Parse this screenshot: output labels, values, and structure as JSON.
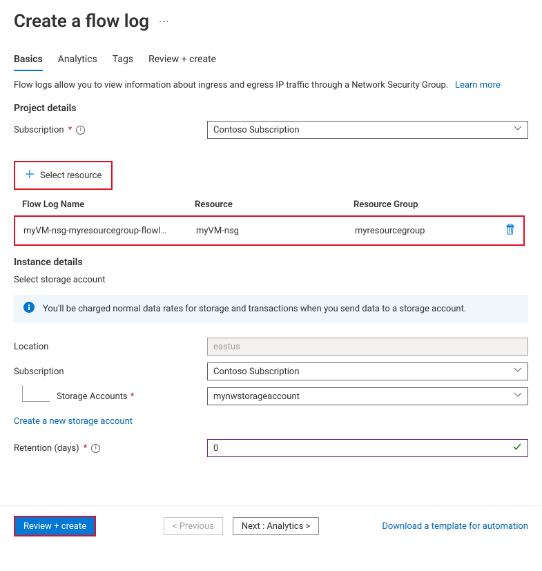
{
  "header": {
    "title": "Create a flow log"
  },
  "tabs": [
    {
      "label": "Basics",
      "active": true
    },
    {
      "label": "Analytics",
      "active": false
    },
    {
      "label": "Tags",
      "active": false
    },
    {
      "label": "Review + create",
      "active": false
    }
  ],
  "description": {
    "text": "Flow logs allow you to view information about ingress and egress IP traffic through a Network Security Group.",
    "learn_more": "Learn more"
  },
  "project": {
    "section_title": "Project details",
    "subscription_label": "Subscription",
    "subscription_value": "Contoso Subscription"
  },
  "select_resource_label": "Select resource",
  "resource_table": {
    "headers": {
      "name": "Flow Log Name",
      "resource": "Resource",
      "group": "Resource Group"
    },
    "row": {
      "name": "myVM-nsg-myresourcegroup-flowl…",
      "resource": "myVM-nsg",
      "group": "myresourcegroup"
    }
  },
  "instance": {
    "section_title": "Instance details",
    "subtitle": "Select storage account",
    "banner": "You'll be charged normal data rates for storage and transactions when you send data to a storage account.",
    "location_label": "Location",
    "location_value": "eastus",
    "subscription_label": "Subscription",
    "subscription_value": "Contoso Subscription",
    "storage_label": "Storage Accounts",
    "storage_value": "mynwstorageaccount",
    "new_storage_link": "Create a new storage account",
    "retention_label": "Retention (days)",
    "retention_value": "0"
  },
  "footer": {
    "review": "Review + create",
    "previous": "< Previous",
    "next": "Next : Analytics >",
    "download": "Download a template for automation"
  }
}
